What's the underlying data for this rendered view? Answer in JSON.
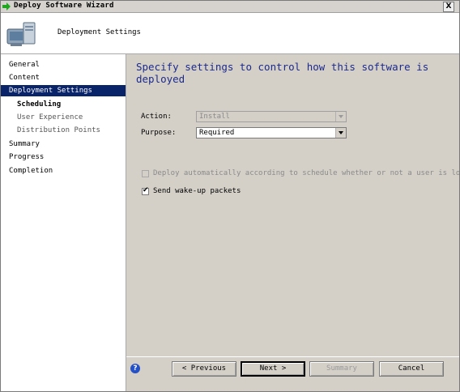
{
  "window": {
    "title": "Deploy Software Wizard",
    "close_glyph": "X"
  },
  "header": {
    "title": "Deployment Settings",
    "icon": "computer-monitor-icon"
  },
  "sidebar": {
    "items": [
      {
        "label": "General",
        "level": 0,
        "selected": false
      },
      {
        "label": "Content",
        "level": 0,
        "selected": false
      },
      {
        "label": "Deployment Settings",
        "level": 0,
        "selected": true
      },
      {
        "label": "Scheduling",
        "level": 1,
        "selected": false,
        "emphasized": true
      },
      {
        "label": "User Experience",
        "level": 1,
        "selected": false
      },
      {
        "label": "Distribution Points",
        "level": 1,
        "selected": false
      },
      {
        "label": "Summary",
        "level": 0,
        "selected": false
      },
      {
        "label": "Progress",
        "level": 0,
        "selected": false
      },
      {
        "label": "Completion",
        "level": 0,
        "selected": false
      }
    ]
  },
  "main": {
    "heading": "Specify settings to control how this software is deployed",
    "action_label": "Action:",
    "action_value": "Install",
    "purpose_label": "Purpose:",
    "purpose_value": "Required",
    "deploy_auto_label": "Deploy automatically according to schedule whether or not a user is logged on",
    "deploy_auto_checked": false,
    "wakeup_label": "Send wake-up packets",
    "wakeup_checked": true
  },
  "footer": {
    "help_glyph": "?",
    "previous_label": "< Previous",
    "next_label": "Next >",
    "summary_label": "Summary",
    "cancel_label": "Cancel"
  },
  "colors": {
    "selection": "#0a246a",
    "heading": "#1c2a8c",
    "panel": "#d4d0c8"
  }
}
